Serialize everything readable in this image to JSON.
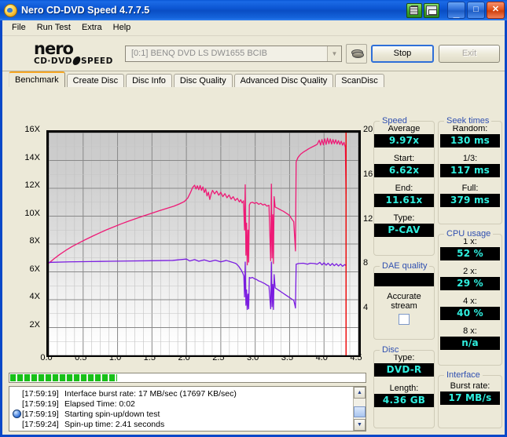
{
  "window": {
    "title": "Nero CD-DVD Speed 4.7.7.5",
    "icon": "nero-app-icon",
    "buttons": {
      "copy": "copy-to-clipboard",
      "save": "save-results",
      "minimize": "_",
      "maximize": "□",
      "close": "✕"
    }
  },
  "menu": [
    "File",
    "Run Test",
    "Extra",
    "Help"
  ],
  "logo": {
    "line1": "nero",
    "line2a": "CD·DVD",
    "line2b": "SPEED"
  },
  "toolbar": {
    "drive": "[0:1]   BENQ DVD LS DW1655 BCIB",
    "drive_icon": "disc-stack-icon",
    "stop_label": "Stop",
    "exit_label": "Exit"
  },
  "tabs": [
    {
      "label": "Benchmark",
      "active": true
    },
    {
      "label": "Create Disc",
      "active": false
    },
    {
      "label": "Disc Info",
      "active": false
    },
    {
      "label": "Disc Quality",
      "active": false
    },
    {
      "label": "Advanced Disc Quality",
      "active": false
    },
    {
      "label": "ScanDisc",
      "active": false
    }
  ],
  "chart_data": {
    "type": "line",
    "title": "",
    "xlabel": "",
    "ylabel": "",
    "xlim": [
      0.0,
      4.5
    ],
    "ylim": [
      0,
      16
    ],
    "ylim_right": [
      0,
      20
    ],
    "grid": true,
    "legend": "none",
    "x_ticks": [
      "0.0",
      "0.5",
      "1.0",
      "1.5",
      "2.0",
      "2.5",
      "3.0",
      "3.5",
      "4.0",
      "4.5"
    ],
    "y_ticks_left": [
      "2X",
      "4X",
      "6X",
      "8X",
      "10X",
      "12X",
      "14X",
      "16X"
    ],
    "y_ticks_right": [
      "4",
      "8",
      "12",
      "16",
      "20"
    ],
    "markers": [
      {
        "name": "position-marker",
        "x": 4.32,
        "color": "#ee0000"
      }
    ],
    "series": [
      {
        "name": "read-speed",
        "color": "#ee1a76",
        "axis": "left",
        "points": [
          [
            0.0,
            6.62
          ],
          [
            0.08,
            6.95
          ],
          [
            0.16,
            7.25
          ],
          [
            0.25,
            7.55
          ],
          [
            0.34,
            7.82
          ],
          [
            0.44,
            8.08
          ],
          [
            0.54,
            8.33
          ],
          [
            0.64,
            8.57
          ],
          [
            0.74,
            8.8
          ],
          [
            0.84,
            9.02
          ],
          [
            0.95,
            9.24
          ],
          [
            1.05,
            9.44
          ],
          [
            1.16,
            9.64
          ],
          [
            1.27,
            9.83
          ],
          [
            1.38,
            10.02
          ],
          [
            1.49,
            10.2
          ],
          [
            1.6,
            10.38
          ],
          [
            1.71,
            10.55
          ],
          [
            1.82,
            10.72
          ],
          [
            1.9,
            10.88
          ],
          [
            1.97,
            11.05
          ],
          [
            2.02,
            11.3
          ],
          [
            2.06,
            11.7
          ],
          [
            2.09,
            12.05
          ],
          [
            2.12,
            12.22
          ],
          [
            2.14,
            11.95
          ],
          [
            2.16,
            12.18
          ],
          [
            2.18,
            11.9
          ],
          [
            2.2,
            12.2
          ],
          [
            2.22,
            11.85
          ],
          [
            2.24,
            12.1
          ],
          [
            2.26,
            11.7
          ],
          [
            2.28,
            11.95
          ],
          [
            2.3,
            11.45
          ],
          [
            2.32,
            11.72
          ],
          [
            2.34,
            11.2
          ],
          [
            2.36,
            11.6
          ],
          [
            2.38,
            11.85
          ],
          [
            2.41,
            11.6
          ],
          [
            2.44,
            11.8
          ],
          [
            2.47,
            11.5
          ],
          [
            2.5,
            11.72
          ],
          [
            2.53,
            11.4
          ],
          [
            2.56,
            11.62
          ],
          [
            2.59,
            11.32
          ],
          [
            2.62,
            11.52
          ],
          [
            2.65,
            11.22
          ],
          [
            2.68,
            11.4
          ],
          [
            2.71,
            11.12
          ],
          [
            2.74,
            11.28
          ],
          [
            2.77,
            11.02
          ],
          [
            2.79,
            11.18
          ],
          [
            2.81,
            10.95
          ],
          [
            2.83,
            11.1
          ],
          [
            2.845,
            9.0
          ],
          [
            2.855,
            12.25
          ],
          [
            2.865,
            7.2
          ],
          [
            2.875,
            9.5
          ],
          [
            2.885,
            6.5
          ],
          [
            2.895,
            9.0
          ],
          [
            2.905,
            6.7
          ],
          [
            2.915,
            10.8
          ],
          [
            2.93,
            10.95
          ],
          [
            2.96,
            11.0
          ],
          [
            2.99,
            10.92
          ],
          [
            3.02,
            10.98
          ],
          [
            3.05,
            10.85
          ],
          [
            3.08,
            10.92
          ],
          [
            3.11,
            10.8
          ],
          [
            3.14,
            10.86
          ],
          [
            3.17,
            10.72
          ],
          [
            3.2,
            10.78
          ],
          [
            3.225,
            6.8
          ],
          [
            3.235,
            12.3
          ],
          [
            3.245,
            7.0
          ],
          [
            3.255,
            10.1
          ],
          [
            3.265,
            6.6
          ],
          [
            3.275,
            11.4
          ],
          [
            3.29,
            10.65
          ],
          [
            3.32,
            10.58
          ],
          [
            3.35,
            10.5
          ],
          [
            3.38,
            10.42
          ],
          [
            3.41,
            10.35
          ],
          [
            3.44,
            10.25
          ],
          [
            3.47,
            10.15
          ],
          [
            3.5,
            10.05
          ],
          [
            3.53,
            9.8
          ],
          [
            3.56,
            9.6
          ],
          [
            3.585,
            7.5
          ],
          [
            3.595,
            13.9
          ],
          [
            3.62,
            14.2
          ],
          [
            3.66,
            14.45
          ],
          [
            3.7,
            14.6
          ],
          [
            3.74,
            14.72
          ],
          [
            3.78,
            14.85
          ],
          [
            3.82,
            14.95
          ],
          [
            3.86,
            15.05
          ],
          [
            3.9,
            15.15
          ],
          [
            3.93,
            15.45
          ],
          [
            3.95,
            15.1
          ],
          [
            3.97,
            15.5
          ],
          [
            3.99,
            15.12
          ],
          [
            4.01,
            15.55
          ],
          [
            4.03,
            15.15
          ],
          [
            4.05,
            15.6
          ],
          [
            4.07,
            15.2
          ],
          [
            4.09,
            15.55
          ],
          [
            4.11,
            15.18
          ],
          [
            4.13,
            15.5
          ],
          [
            4.15,
            15.2
          ],
          [
            4.17,
            15.48
          ],
          [
            4.19,
            15.18
          ],
          [
            4.21,
            15.42
          ],
          [
            4.23,
            15.15
          ],
          [
            4.25,
            15.38
          ],
          [
            4.27,
            15.1
          ],
          [
            4.29,
            15.3
          ],
          [
            4.31,
            14.95
          ],
          [
            4.32,
            11.61
          ]
        ]
      },
      {
        "name": "cpu-transfer",
        "color": "#7a1de0",
        "axis": "left",
        "points": [
          [
            0.0,
            6.68
          ],
          [
            0.3,
            6.72
          ],
          [
            0.6,
            6.74
          ],
          [
            0.9,
            6.76
          ],
          [
            1.2,
            6.78
          ],
          [
            1.5,
            6.8
          ],
          [
            1.8,
            6.82
          ],
          [
            2.0,
            6.92
          ],
          [
            2.05,
            6.78
          ],
          [
            2.12,
            6.88
          ],
          [
            2.18,
            6.76
          ],
          [
            2.26,
            6.86
          ],
          [
            2.34,
            6.74
          ],
          [
            2.42,
            6.84
          ],
          [
            2.5,
            6.72
          ],
          [
            2.58,
            6.82
          ],
          [
            2.66,
            6.7
          ],
          [
            2.72,
            6.6
          ],
          [
            2.76,
            6.4
          ],
          [
            2.8,
            6.1
          ],
          [
            2.82,
            5.9
          ],
          [
            2.835,
            5.7
          ],
          [
            2.845,
            4.2
          ],
          [
            2.855,
            6.7
          ],
          [
            2.865,
            3.6
          ],
          [
            2.875,
            4.7
          ],
          [
            2.885,
            3.3
          ],
          [
            2.895,
            4.4
          ],
          [
            2.905,
            3.35
          ],
          [
            2.915,
            5.6
          ],
          [
            2.93,
            5.55
          ],
          [
            2.96,
            5.6
          ],
          [
            2.99,
            5.5
          ],
          [
            3.02,
            5.45
          ],
          [
            3.05,
            5.35
          ],
          [
            3.08,
            5.3
          ],
          [
            3.11,
            5.22
          ],
          [
            3.14,
            5.15
          ],
          [
            3.17,
            5.05
          ],
          [
            3.2,
            4.98
          ],
          [
            3.225,
            3.35
          ],
          [
            3.235,
            6.7
          ],
          [
            3.245,
            3.5
          ],
          [
            3.255,
            5.1
          ],
          [
            3.265,
            3.3
          ],
          [
            3.275,
            5.8
          ],
          [
            3.29,
            4.85
          ],
          [
            3.32,
            4.75
          ],
          [
            3.35,
            4.65
          ],
          [
            3.38,
            4.55
          ],
          [
            3.41,
            4.45
          ],
          [
            3.44,
            4.35
          ],
          [
            3.47,
            4.25
          ],
          [
            3.5,
            4.15
          ],
          [
            3.53,
            4.05
          ],
          [
            3.56,
            3.95
          ],
          [
            3.575,
            3.65
          ],
          [
            3.585,
            3.4
          ],
          [
            3.595,
            6.55
          ],
          [
            3.63,
            6.6
          ],
          [
            3.7,
            6.62
          ],
          [
            3.76,
            6.55
          ],
          [
            3.8,
            6.62
          ],
          [
            3.86,
            6.6
          ],
          [
            3.9,
            6.55
          ],
          [
            3.94,
            6.68
          ],
          [
            3.97,
            6.5
          ],
          [
            4.0,
            6.65
          ],
          [
            4.03,
            6.48
          ],
          [
            4.06,
            6.62
          ],
          [
            4.09,
            6.45
          ],
          [
            4.12,
            6.6
          ],
          [
            4.15,
            6.44
          ],
          [
            4.18,
            6.58
          ],
          [
            4.21,
            6.42
          ],
          [
            4.24,
            6.56
          ],
          [
            4.27,
            6.4
          ],
          [
            4.3,
            6.52
          ],
          [
            4.32,
            6.45
          ]
        ]
      }
    ]
  },
  "progress": {
    "percent": 30
  },
  "log": [
    {
      "icon": "",
      "time": "[17:59:19]",
      "message": "Interface burst rate: 17 MB/sec (17697 KB/sec)"
    },
    {
      "icon": "",
      "time": "[17:59:19]",
      "message": "Elapsed Time:  0:02"
    },
    {
      "icon": "info-globe-icon",
      "time": "[17:59:19]",
      "message": "Starting spin-up/down test"
    },
    {
      "icon": "",
      "time": "[17:59:24]",
      "message": "Spin-up time: 2.41 seconds"
    }
  ],
  "panels": {
    "speed": {
      "caption": "Speed",
      "rows": [
        {
          "label": "Average",
          "value": "9.97x"
        },
        {
          "label": "Start:",
          "value": "6.62x"
        },
        {
          "label": "End:",
          "value": "11.61x"
        },
        {
          "label": "Type:",
          "value": "P-CAV"
        }
      ]
    },
    "dae": {
      "caption": "DAE quality",
      "value": "",
      "note1": "Accurate",
      "note2": "stream",
      "checked": false
    },
    "disc": {
      "caption": "Disc",
      "rows": [
        {
          "label": "Type:",
          "value": "DVD-R"
        },
        {
          "label": "Length:",
          "value": "4.36 GB"
        }
      ]
    },
    "seek": {
      "caption": "Seek times",
      "rows": [
        {
          "label": "Random:",
          "value": "130 ms"
        },
        {
          "label": "1/3:",
          "value": "117 ms"
        },
        {
          "label": "Full:",
          "value": "379 ms"
        }
      ]
    },
    "cpu": {
      "caption": "CPU usage",
      "rows": [
        {
          "label": "1 x:",
          "value": "52 %"
        },
        {
          "label": "2 x:",
          "value": "29 %"
        },
        {
          "label": "4 x:",
          "value": "40 %"
        },
        {
          "label": "8 x:",
          "value": "n/a"
        }
      ]
    },
    "interface": {
      "caption": "Interface",
      "rows": [
        {
          "label": "Burst rate:",
          "value": "17 MB/s"
        }
      ]
    }
  },
  "colors": {
    "accent": "#2f4fb0",
    "lcd_text": "#2ff0e0",
    "read_speed": "#ee1a76",
    "cpu_line": "#7a1de0",
    "marker": "#ee0000",
    "tab_active": "#f5a623"
  }
}
